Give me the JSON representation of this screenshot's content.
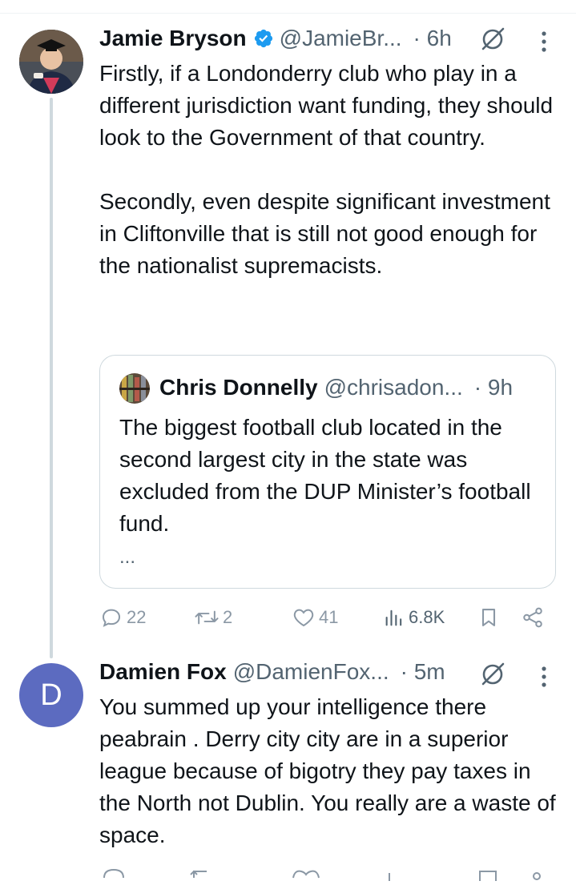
{
  "tweets": [
    {
      "author": "Jamie Bryson",
      "handle": "@JamieBr...",
      "time": "· 6h",
      "text": "Firstly, if a Londonderry club who play in a different jurisdiction want funding, they should look to the Government of that country.\n\nSecondly, even despite significant investment in Cliftonville that is still not good enough for the nationalist supremacists.",
      "quote": {
        "author": "Chris Donnelly",
        "handle": "@chrisadon...",
        "time": "· 9h",
        "text": "The biggest football club located in the second largest city in the state was excluded from the DUP Minister’s football fund.",
        "more": "..."
      },
      "stats": {
        "replies": "22",
        "retweets": "2",
        "likes": "41",
        "views": "6.8K"
      }
    },
    {
      "author": "Damien Fox",
      "handle": "@DamienFox...",
      "time": "· 5m",
      "avatar_letter": "D",
      "text": "You summed up your intelligence there peabrain . Derry city city are in a superior league because of bigotry they pay taxes in the North not Dublin. You really are a waste of space."
    }
  ],
  "icons": {
    "verified": "verified-badge-icon",
    "grok": "grok-icon",
    "more": "more-vertical-icon",
    "reply": "reply-icon",
    "retweet": "retweet-icon",
    "like": "like-icon",
    "views": "views-icon",
    "bookmark": "bookmark-icon",
    "share": "share-icon"
  },
  "colors": {
    "verified": "#1d9bf0",
    "secondary_text": "#536471",
    "action_icon": "#8b98a5",
    "avatar_fox": "#5c6bc0"
  }
}
